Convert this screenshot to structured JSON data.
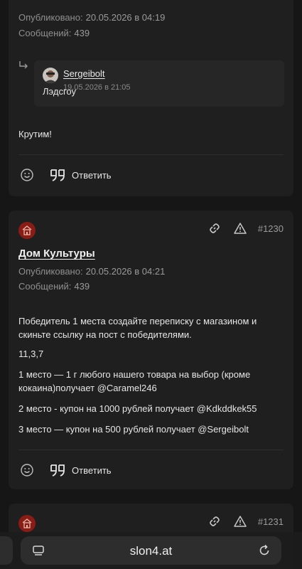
{
  "post1": {
    "meta": {
      "published_label": "Опубликовано:",
      "published_value": "20.05.2026 в 04:19",
      "messages_label": "Сообщений:",
      "messages_value": "439"
    },
    "quote": {
      "author": "Sergeibolt",
      "date": "19.05.2026 в 21:05",
      "text": "Лэдсгоу"
    },
    "text": "Крутим!",
    "reply_label": "Ответить"
  },
  "post2": {
    "number": "#1230",
    "author": "Дом Культуры",
    "meta": {
      "published_label": "Опубликовано:",
      "published_value": "20.05.2026 в 04:21",
      "messages_label": "Сообщений:",
      "messages_value": "439"
    },
    "paragraphs": [
      "Победитель 1 места создайте переписку с магазином и скиньте ссылку на пост с победителями.",
      "11,3,7",
      "1 место — 1 г любого нашего товара на выбор (кроме кокаина)получает @Caramel246",
      "2 место - купон на 1000 рублей  получает @Kdkddkek55",
      "3 место — купон на 500 рублей получает @Sergeibolt"
    ],
    "reply_label": "Ответить"
  },
  "post3": {
    "number": "#1231"
  },
  "browser": {
    "url": "slon4.at"
  },
  "colors": {
    "background": "#161616",
    "card": "#1f1f1f",
    "badge": "#8a1c16"
  }
}
